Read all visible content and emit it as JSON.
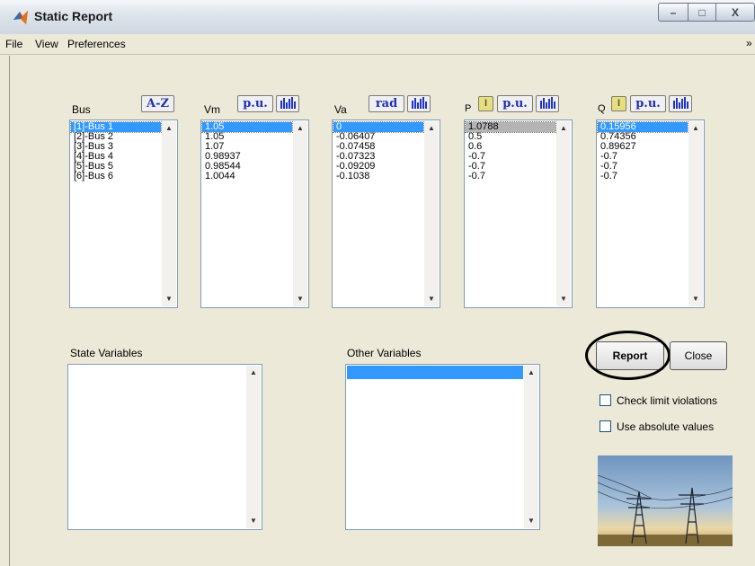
{
  "window": {
    "title": "Static Report",
    "min_glyph": "–",
    "max_glyph": "□",
    "close_glyph": "X"
  },
  "menu": {
    "items": [
      "File",
      "View",
      "Preferences"
    ],
    "overflow": "»"
  },
  "columns": {
    "bus": {
      "label": "Bus",
      "sort_btn": "A-Z",
      "values": [
        "[1]-Bus 1",
        "[2]-Bus 2",
        "[3]-Bus 3",
        "[4]-Bus 4",
        "[5]-Bus 5",
        "[6]-Bus 6"
      ]
    },
    "vm": {
      "label": "Vm",
      "unit_btn": "p.u.",
      "values": [
        "1.05",
        "1.05",
        "1.07",
        "0.98937",
        "0.98544",
        "1.0044"
      ]
    },
    "va": {
      "label": "Va",
      "unit_btn": "rad",
      "values": [
        "0",
        "-0.06407",
        "-0.07458",
        "-0.07323",
        "-0.09209",
        "-0.1038"
      ]
    },
    "p": {
      "label": "P",
      "i_btn": "I",
      "unit_btn": "p.u.",
      "values": [
        "1.0788",
        "0.5",
        "0.6",
        "-0.7",
        "-0.7",
        "-0.7"
      ]
    },
    "q": {
      "label": "Q",
      "i_btn": "I",
      "unit_btn": "p.u.",
      "values": [
        "0.15956",
        "0.74356",
        "0.89627",
        "-0.7",
        "-0.7",
        "-0.7"
      ]
    }
  },
  "state_variables": {
    "label": "State Variables"
  },
  "other_variables": {
    "label": "Other Variables"
  },
  "buttons": {
    "report": "Report",
    "close": "Close"
  },
  "options": {
    "check_limit_violations": {
      "label": "Check limit violations",
      "checked": false
    },
    "use_absolute_values": {
      "label": "Use absolute values",
      "checked": false
    }
  },
  "icons": {
    "app": "matlab-logo-icon",
    "scroll_up": "▲",
    "scroll_down": "▼"
  }
}
